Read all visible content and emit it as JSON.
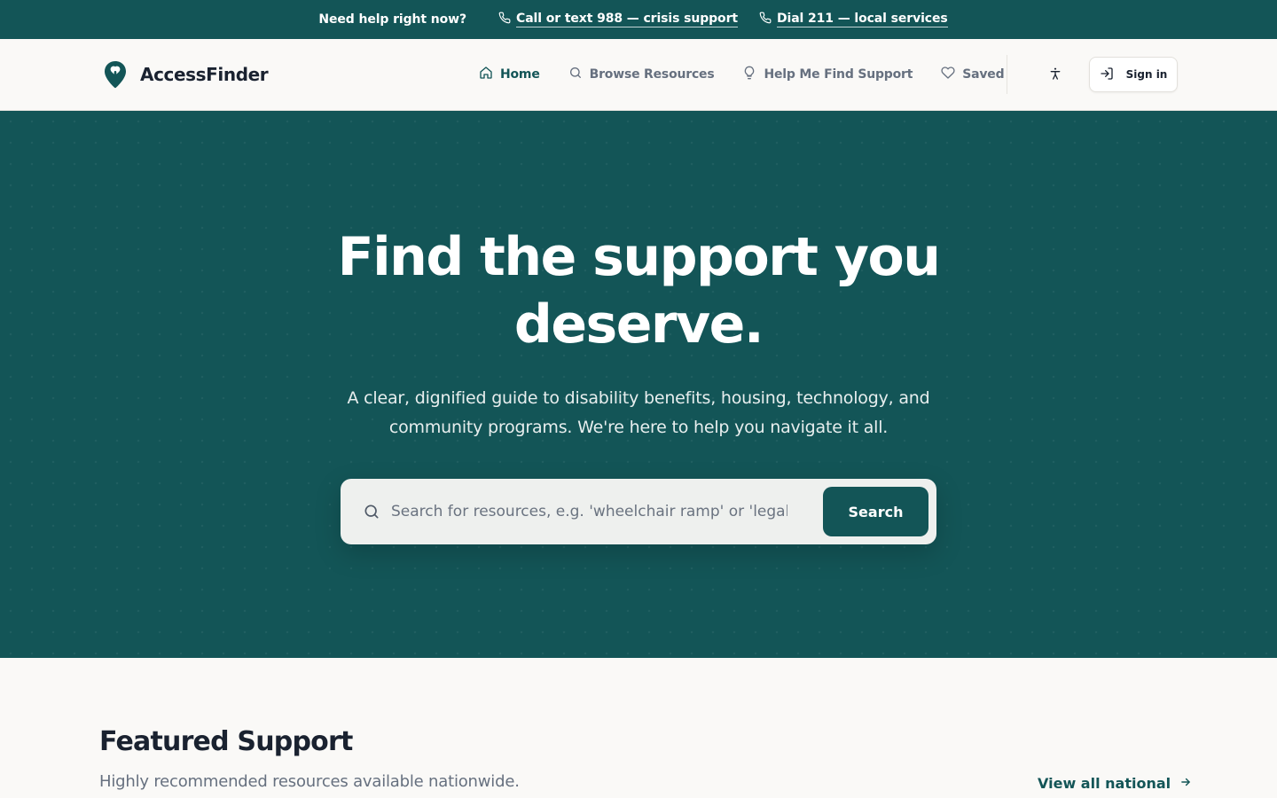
{
  "colors": {
    "brand_teal": "#135557",
    "page_background": "#faf9f7",
    "text_dark": "#1a2230",
    "text_muted": "#66707f"
  },
  "crisis_bar": {
    "prompt": "Need help right now?",
    "links": [
      {
        "icon": "phone-icon",
        "label": "Call or text 988 — crisis support"
      },
      {
        "icon": "phone-icon",
        "label": "Dial 211 — local services"
      }
    ]
  },
  "header": {
    "brand": {
      "icon": "map-pin-logo-icon",
      "name": "AccessFinder"
    },
    "nav": [
      {
        "icon": "home-icon",
        "label": "Home",
        "active": true
      },
      {
        "icon": "search-icon",
        "label": "Browse Resources",
        "active": false
      },
      {
        "icon": "lightbulb-icon",
        "label": "Help Me Find Support",
        "active": false
      },
      {
        "icon": "heart-icon",
        "label": "Saved",
        "active": false
      }
    ],
    "accessibility_icon": "accessibility-icon",
    "sign_in": {
      "icon": "sign-in-icon",
      "label": "Sign in"
    }
  },
  "hero": {
    "title_line1": "Find the support you",
    "title_line2": "deserve.",
    "subtitle_line1": "A clear, dignified guide to disability benefits, housing, technology, and",
    "subtitle_line2": "community programs. We're here to help you navigate it all.",
    "search": {
      "icon": "search-icon",
      "placeholder": "Search for resources, e.g. 'wheelchair ramp' or 'legal aid'",
      "value": "",
      "button_label": "Search"
    }
  },
  "featured": {
    "title": "Featured Support",
    "subtitle": "Highly recommended resources available nationwide.",
    "view_all": {
      "label": "View all national",
      "icon": "arrow-right-icon"
    }
  }
}
